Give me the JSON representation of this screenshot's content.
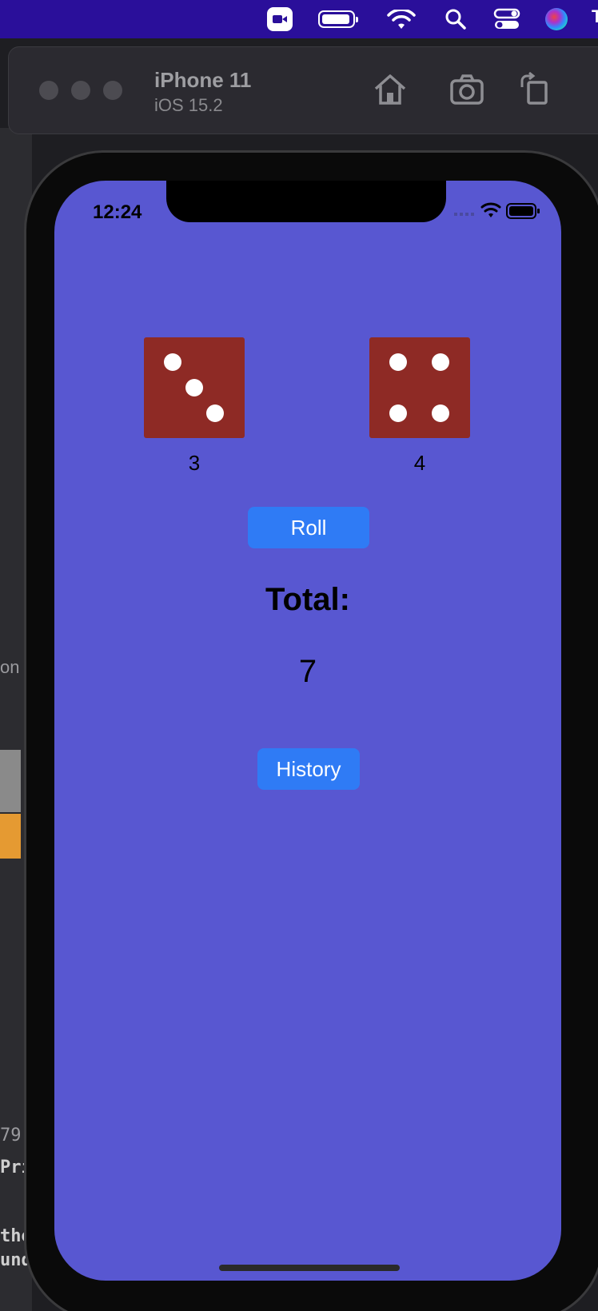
{
  "menubar": {
    "overflow_text": "T"
  },
  "xcode": {
    "left_fragments": [
      "on",
      "79",
      "Pri",
      "the",
      "unde"
    ]
  },
  "simulator": {
    "device_name": "iPhone 11",
    "os_version": "iOS 15.2"
  },
  "status_bar": {
    "time": "12:24"
  },
  "dice": [
    {
      "value": "3"
    },
    {
      "value": "4"
    }
  ],
  "roll_button": {
    "label": "Roll"
  },
  "total": {
    "label": "Total:",
    "value": "7"
  },
  "history_button": {
    "label": "History"
  },
  "colors": {
    "screen_background": "#5857d1",
    "die_face": "#8e2a25",
    "button": "#2f7bf5",
    "menubar": "#2a0f9a"
  }
}
